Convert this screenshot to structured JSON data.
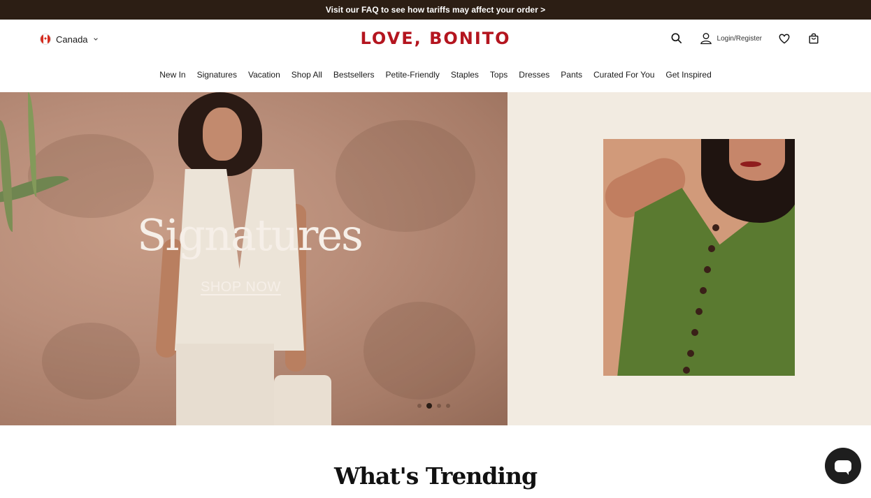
{
  "announcement": {
    "text": "Visit our FAQ to see how tariffs may affect your order >"
  },
  "header": {
    "region": "Canada",
    "logo": "LOVE, BONITO",
    "login_label": "Login/Register"
  },
  "nav": [
    {
      "label": "New In"
    },
    {
      "label": "Signatures"
    },
    {
      "label": "Vacation"
    },
    {
      "label": "Shop All"
    },
    {
      "label": "Bestsellers"
    },
    {
      "label": "Petite-Friendly"
    },
    {
      "label": "Staples"
    },
    {
      "label": "Tops"
    },
    {
      "label": "Dresses"
    },
    {
      "label": "Pants"
    },
    {
      "label": "Curated For You"
    },
    {
      "label": "Get Inspired"
    }
  ],
  "hero": {
    "title": "Signatures",
    "cta": "SHOP NOW",
    "slides_total": 4,
    "active_slide": 2
  },
  "section": {
    "title": "What's Trending"
  },
  "colors": {
    "announcement_bg": "#2c1e14",
    "logo": "#b4151f",
    "hero_right_bg": "#f2ebe1"
  },
  "icons": [
    "canada-flag-icon",
    "chevron-down-icon",
    "search-icon",
    "user-icon",
    "heart-icon",
    "shopping-bag-icon",
    "chat-icon"
  ]
}
